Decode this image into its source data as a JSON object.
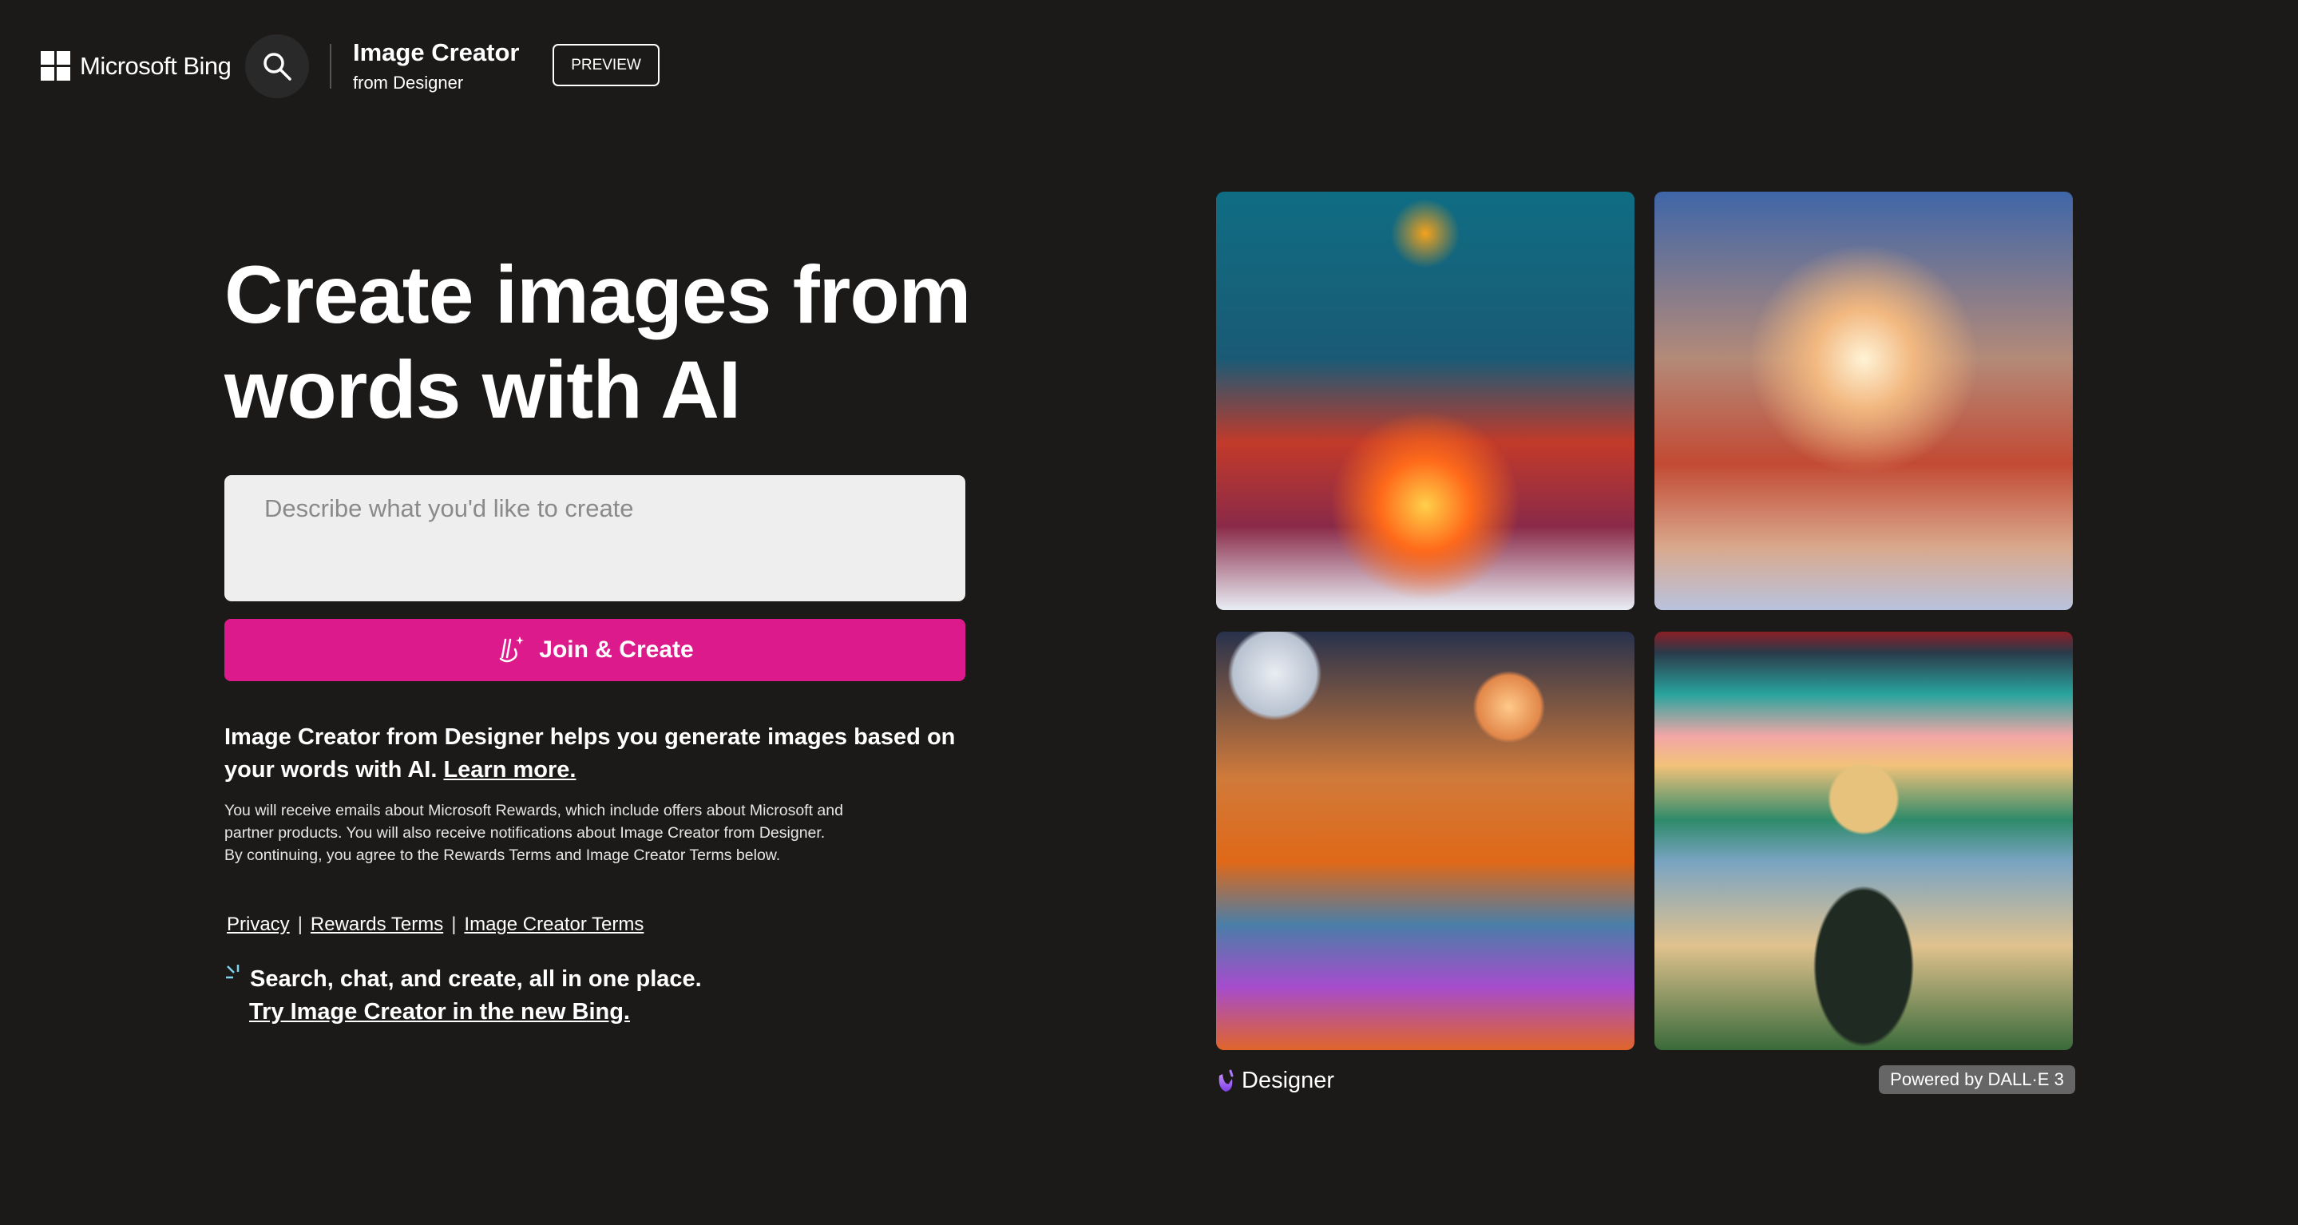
{
  "header": {
    "brand": "Microsoft Bing",
    "app_title": "Image Creator",
    "app_subtitle": "from Designer",
    "preview_badge": "PREVIEW"
  },
  "hero": {
    "title_line1": "Create images from",
    "title_line2": "words with AI"
  },
  "prompt": {
    "placeholder": "Describe what you'd like to create",
    "value": ""
  },
  "join_button": "Join & Create",
  "description": {
    "text": "Image Creator from Designer helps you generate images based on your words with AI.",
    "learn_more": "Learn more."
  },
  "legal_text": "You will receive emails about Microsoft Rewards, which include offers about Microsoft and partner products. You will also receive notifications about Image Creator from Designer. By continuing, you agree to the Rewards Terms and Image Creator Terms below.",
  "links": {
    "privacy": "Privacy",
    "separator": "|",
    "rewards_terms": "Rewards Terms",
    "image_creator_terms": "Image Creator Terms"
  },
  "promo": {
    "headline": "Search, chat, and create, all in one place.",
    "link": "Try Image Creator in the new Bing."
  },
  "gallery": {
    "designer_label": "Designer",
    "powered_by": "Powered by DALL·E 3"
  },
  "colors": {
    "background": "#1b1a19",
    "accent": "#dd1a8b",
    "input_bg": "#eeeeee"
  }
}
